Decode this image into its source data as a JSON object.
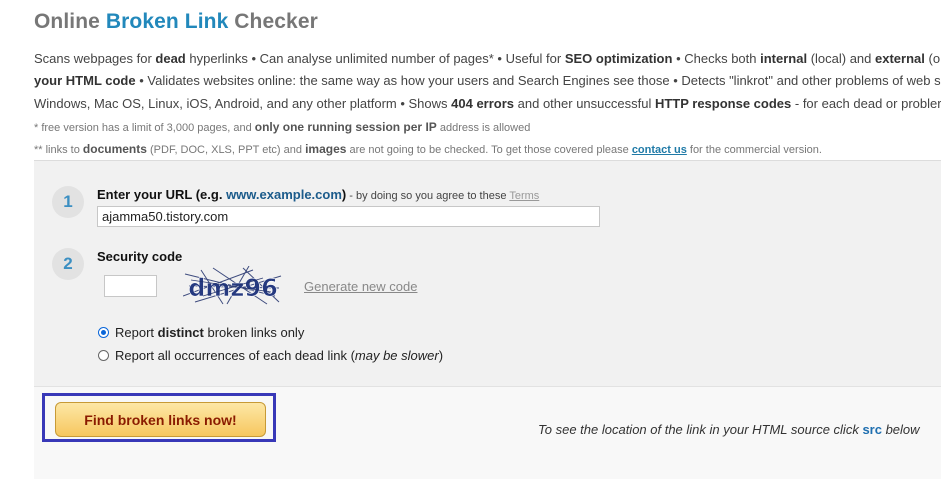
{
  "header": {
    "title_prefix": "Online",
    "title_accent": "Broken Link",
    "title_suffix": "Checker"
  },
  "description": {
    "line1": {
      "t1": "Scans webpages for ",
      "b1": "dead",
      "t2": " hyperlinks • Can analyse unlimited number of pages* • Useful for ",
      "b2": "SEO optimization",
      "t3": " • Checks both ",
      "b3": "internal",
      "t4": " (local) and ",
      "b4": "external",
      "t5": " (o"
    },
    "line2": {
      "b1": "your HTML code",
      "t1": " • Validates websites online: the same way as how your users and Search Engines see those • Detects \"linkrot\" and other problems of web s"
    },
    "line3": {
      "t1": "Windows, Mac OS, Linux, iOS, Android, and any other platform • Shows ",
      "b1": "404 errors",
      "t2": " and other unsuccessful ",
      "b2": "HTTP response codes",
      "t3": " - for each dead or probler"
    }
  },
  "notes": {
    "note1": {
      "t1": "*  free version has a limit of 3,000 pages, and ",
      "b1": "only one running session per IP",
      "t2": " address is allowed"
    },
    "note2": {
      "t1": "** links to ",
      "b1": "documents",
      "t2": " (PDF, DOC, XLS, PPT etc) and ",
      "b2": "images",
      "t3": " are not going to be checked. To get those covered please ",
      "link": "contact us",
      "t4": " for the commercial version."
    }
  },
  "form": {
    "step1": {
      "number": "1",
      "label": "Enter your URL (e.g. ",
      "example": "www.example.com",
      "label_end": ")",
      "fine": " - by doing so you agree to these ",
      "terms": "Terms",
      "url_value": "ajamma50.tistory.com"
    },
    "step2": {
      "number": "2",
      "label": "Security code",
      "captcha_text": "dmz96",
      "generate_link": "Generate new code"
    },
    "options": [
      {
        "pre": "Report ",
        "bold": "distinct",
        "post": " broken links only",
        "checked": true
      },
      {
        "pre": "Report all occurrences of each dead link (",
        "italic": "may be slower",
        "post": ")",
        "checked": false
      }
    ]
  },
  "actions": {
    "submit_label": "Find broken links now!",
    "hint_pre": "To see the location of the link in your HTML source click ",
    "hint_src": "src",
    "hint_post": " below"
  },
  "colors": {
    "accent": "#2288bb",
    "highlight_border": "#3838b8",
    "button_text": "#8a1b00"
  }
}
